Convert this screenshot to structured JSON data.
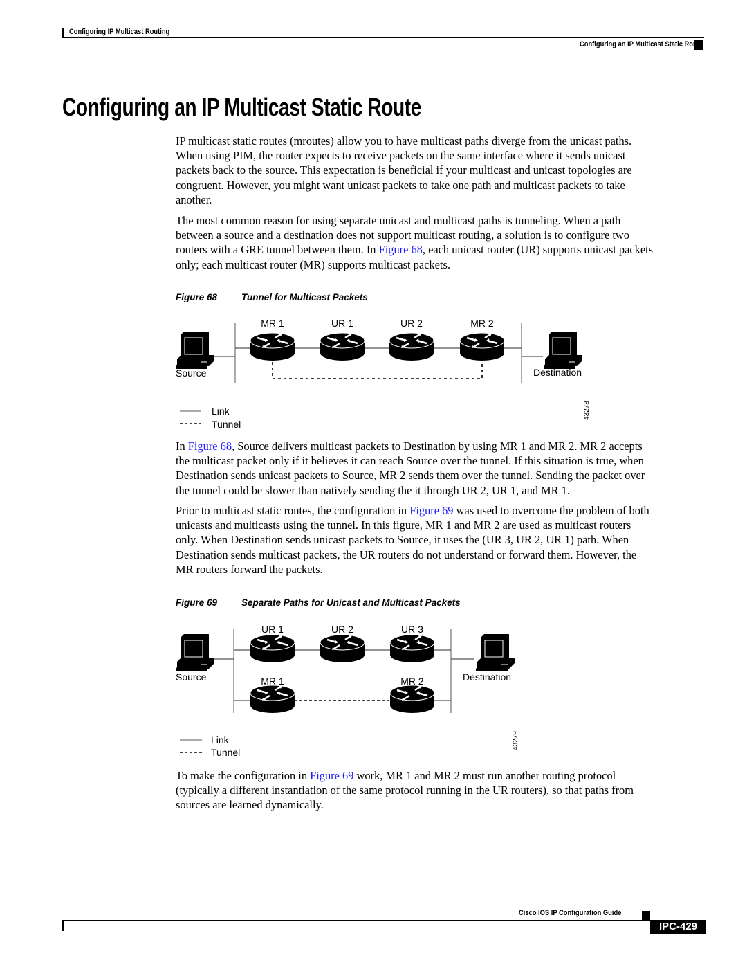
{
  "header": {
    "chapter": "Configuring IP Multicast Routing",
    "section": "Configuring an IP Multicast Static Route"
  },
  "title": "Configuring an IP Multicast Static Route",
  "paragraphs": {
    "p1": [
      "IP multicast static routes (mroutes) allow you to have multicast paths diverge from the unicast paths.",
      "When using PIM, the router expects to receive packets on the same interface where it sends unicast",
      "packets back to the source. This expectation is beneficial if your multicast and unicast topologies are",
      "congruent. However, you might want unicast packets to take one path and multicast packets to take",
      "another."
    ],
    "p2": {
      "l1": "The most common reason for using separate unicast and multicast paths is tunneling. When a path",
      "l2": "between a source and a destination does not support multicast routing, a solution is to configure two",
      "l3_before": "routers with a GRE tunnel between them. In ",
      "l3_link": "Figure 68",
      "l3_after": ", each unicast router (UR) supports unicast packets",
      "l4": "only; each multicast router (MR) supports multicast packets."
    },
    "p3": {
      "l1_before": "In ",
      "l1_link": "Figure 68",
      "l1_after": ", Source delivers multicast packets to Destination by using MR 1 and MR 2. MR 2 accepts",
      "l2": "the multicast packet only if it believes it can reach Source over the tunnel. If this situation is true, when",
      "l3": "Destination sends unicast packets to Source, MR 2 sends them over the tunnel. Sending the packet over",
      "l4": "the tunnel could be slower than natively sending the it through UR 2, UR 1, and MR 1."
    },
    "p4": {
      "l1_before": "Prior to multicast static routes, the configuration in ",
      "l1_link": "Figure 69",
      "l1_after": " was used to overcome the problem of both",
      "l2": "unicasts and multicasts using the tunnel. In this figure, MR 1 and MR 2 are used as multicast routers",
      "l3": "only. When Destination sends unicast packets to Source, it uses the (UR 3, UR 2, UR 1) path. When",
      "l4": "Destination sends multicast packets, the UR routers do not understand or forward them. However, the",
      "l5": "MR routers forward the packets."
    },
    "p5": {
      "l1_before": "To make the configuration in ",
      "l1_link": "Figure 69",
      "l1_after": " work, MR 1 and MR 2 must run another routing protocol",
      "l2": "(typically a different instantiation of the same protocol running in the UR routers), so that paths from",
      "l3": "sources are learned dynamically."
    }
  },
  "figure68": {
    "number": "Figure 68",
    "caption": "Tunnel for Multicast Packets",
    "routers": [
      "MR 1",
      "UR 1",
      "UR 2",
      "MR 2"
    ],
    "source_label": "Source",
    "destination_label": "Destination",
    "legend_link": "Link",
    "legend_tunnel": "Tunnel",
    "art_id": "43278"
  },
  "figure69": {
    "number": "Figure 69",
    "caption": "Separate Paths for Unicast and Multicast Packets",
    "unicast_routers": [
      "UR 1",
      "UR 2",
      "UR 3"
    ],
    "multicast_routers": [
      "MR 1",
      "MR 2"
    ],
    "source_label": "Source",
    "destination_label": "Destination",
    "legend_link": "Link",
    "legend_tunnel": "Tunnel",
    "art_id": "43279"
  },
  "footer": {
    "guide": "Cisco IOS IP Configuration Guide",
    "page": "IPC-429"
  },
  "colors": {
    "link": "#1a1aff",
    "text": "#000000",
    "line_gray": "#888888"
  }
}
